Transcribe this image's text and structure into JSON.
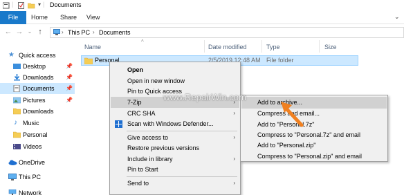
{
  "window": {
    "title": "Documents"
  },
  "ribbon": {
    "tabs": [
      "File",
      "Home",
      "Share",
      "View"
    ]
  },
  "address": {
    "parts": [
      "This PC",
      "Documents"
    ]
  },
  "columns": [
    "Name",
    "Date modified",
    "Type",
    "Size"
  ],
  "sidebar": {
    "items": [
      {
        "label": "Quick access",
        "icon": "star-icon"
      },
      {
        "label": "Desktop",
        "icon": "desktop-icon"
      },
      {
        "label": "Downloads",
        "icon": "download-icon"
      },
      {
        "label": "Documents",
        "icon": "documents-icon"
      },
      {
        "label": "Pictures",
        "icon": "pictures-icon"
      },
      {
        "label": "Downloads",
        "icon": "folder-icon"
      },
      {
        "label": "Music",
        "icon": "music-icon"
      },
      {
        "label": "Personal",
        "icon": "folder-icon"
      },
      {
        "label": "Videos",
        "icon": "videos-icon"
      },
      {
        "label": "OneDrive",
        "icon": "cloud-icon"
      },
      {
        "label": "This PC",
        "icon": "computer-icon"
      },
      {
        "label": "Network",
        "icon": "network-icon"
      }
    ]
  },
  "file_row": {
    "name": "Personal",
    "date": "2/5/2019 12:48 AM",
    "type": "File folder"
  },
  "context_menu": {
    "items": [
      "Open",
      "Open in new window",
      "Pin to Quick access",
      "7-Zip",
      "CRC SHA",
      "Scan with Windows Defender...",
      "Give access to",
      "Restore previous versions",
      "Include in library",
      "Pin to Start",
      "Send to"
    ]
  },
  "submenu": {
    "items": [
      "Add to archive...",
      "Compress and email...",
      "Add to \"Personal.7z\"",
      "Compress to \"Personal.7z\" and email",
      "Add to \"Personal.zip\"",
      "Compress to \"Personal.zip\" and email"
    ]
  },
  "watermark": "www.RepairWin.com",
  "colors": {
    "accent": "#1979ca",
    "selection": "#cce8ff",
    "arrow": "#f08020"
  }
}
